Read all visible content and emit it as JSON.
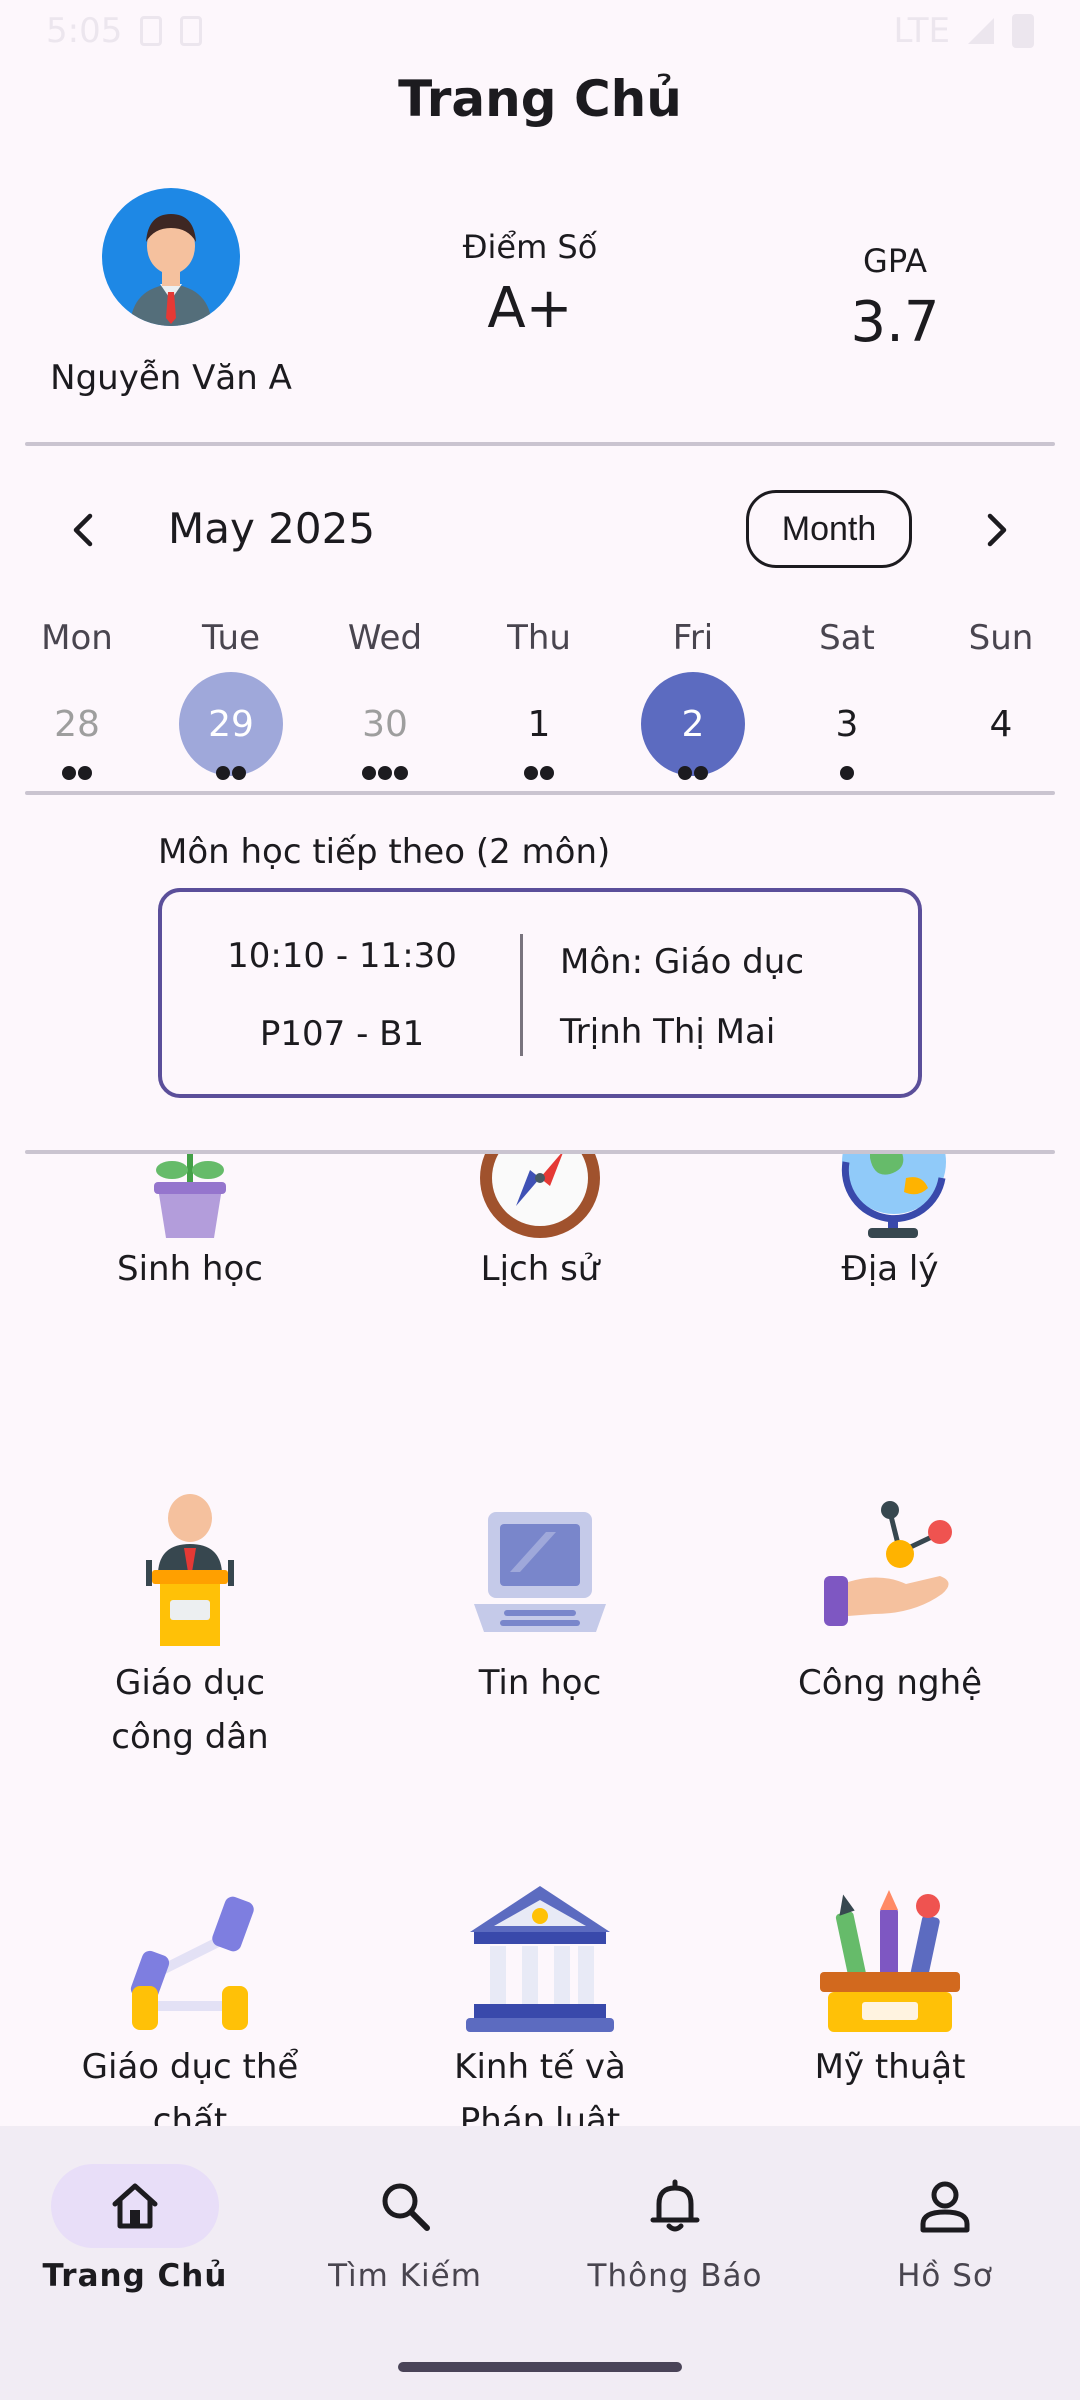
{
  "status_bar": {
    "time": "5:05",
    "network": "LTE"
  },
  "page": {
    "title": "Trang Chủ"
  },
  "profile": {
    "name": "Nguyễn Văn A",
    "score_label": "Điểm Số",
    "score_value": "A+",
    "gpa_label": "GPA",
    "gpa_value": "3.7"
  },
  "calendar": {
    "month_label": "May 2025",
    "view_button": "Month",
    "weekdays": [
      "Mon",
      "Tue",
      "Wed",
      "Thu",
      "Fri",
      "Sat",
      "Sun"
    ],
    "days": [
      {
        "num": "28",
        "state": "muted",
        "dots": 2
      },
      {
        "num": "29",
        "state": "today",
        "dots": 2
      },
      {
        "num": "30",
        "state": "muted",
        "dots": 3
      },
      {
        "num": "1",
        "state": "normal",
        "dots": 2
      },
      {
        "num": "2",
        "state": "selected",
        "dots": 2
      },
      {
        "num": "3",
        "state": "normal",
        "dots": 1
      },
      {
        "num": "4",
        "state": "normal",
        "dots": 0
      }
    ]
  },
  "next_class": {
    "title": "Môn học tiếp theo (2 môn)",
    "time": "10:10 - 11:30",
    "room": "P107 - B1",
    "subject": "Môn: Giáo dục",
    "teacher": "Trịnh Thị Mai"
  },
  "subjects": [
    {
      "label": "Sinh học",
      "icon": "plant-pot-icon"
    },
    {
      "label": "Lịch sử",
      "icon": "compass-icon"
    },
    {
      "label": "Địa lý",
      "icon": "globe-icon"
    },
    {
      "label": "Giáo dục công dân",
      "icon": "speaker-podium-icon"
    },
    {
      "label": "Tin học",
      "icon": "laptop-icon"
    },
    {
      "label": "Công nghệ",
      "icon": "molecule-hand-icon"
    },
    {
      "label": "Giáo dục thể chất",
      "icon": "dumbbell-icon"
    },
    {
      "label": "Kinh tế và Pháp luật",
      "icon": "courthouse-icon"
    },
    {
      "label": "Mỹ thuật",
      "icon": "art-supplies-icon"
    }
  ],
  "nav": {
    "items": [
      {
        "label": "Trang Chủ",
        "icon": "home-icon",
        "active": true
      },
      {
        "label": "Tìm Kiếm",
        "icon": "search-icon",
        "active": false
      },
      {
        "label": "Thông Báo",
        "icon": "bell-icon",
        "active": false
      },
      {
        "label": "Hồ Sơ",
        "icon": "person-icon",
        "active": false
      }
    ]
  },
  "colors": {
    "background": "#FDF7FC",
    "today": "#9FA8DA",
    "selected": "#5C6BC0",
    "card_border": "#5B4F9A",
    "nav_active": "#E8DEF8"
  }
}
